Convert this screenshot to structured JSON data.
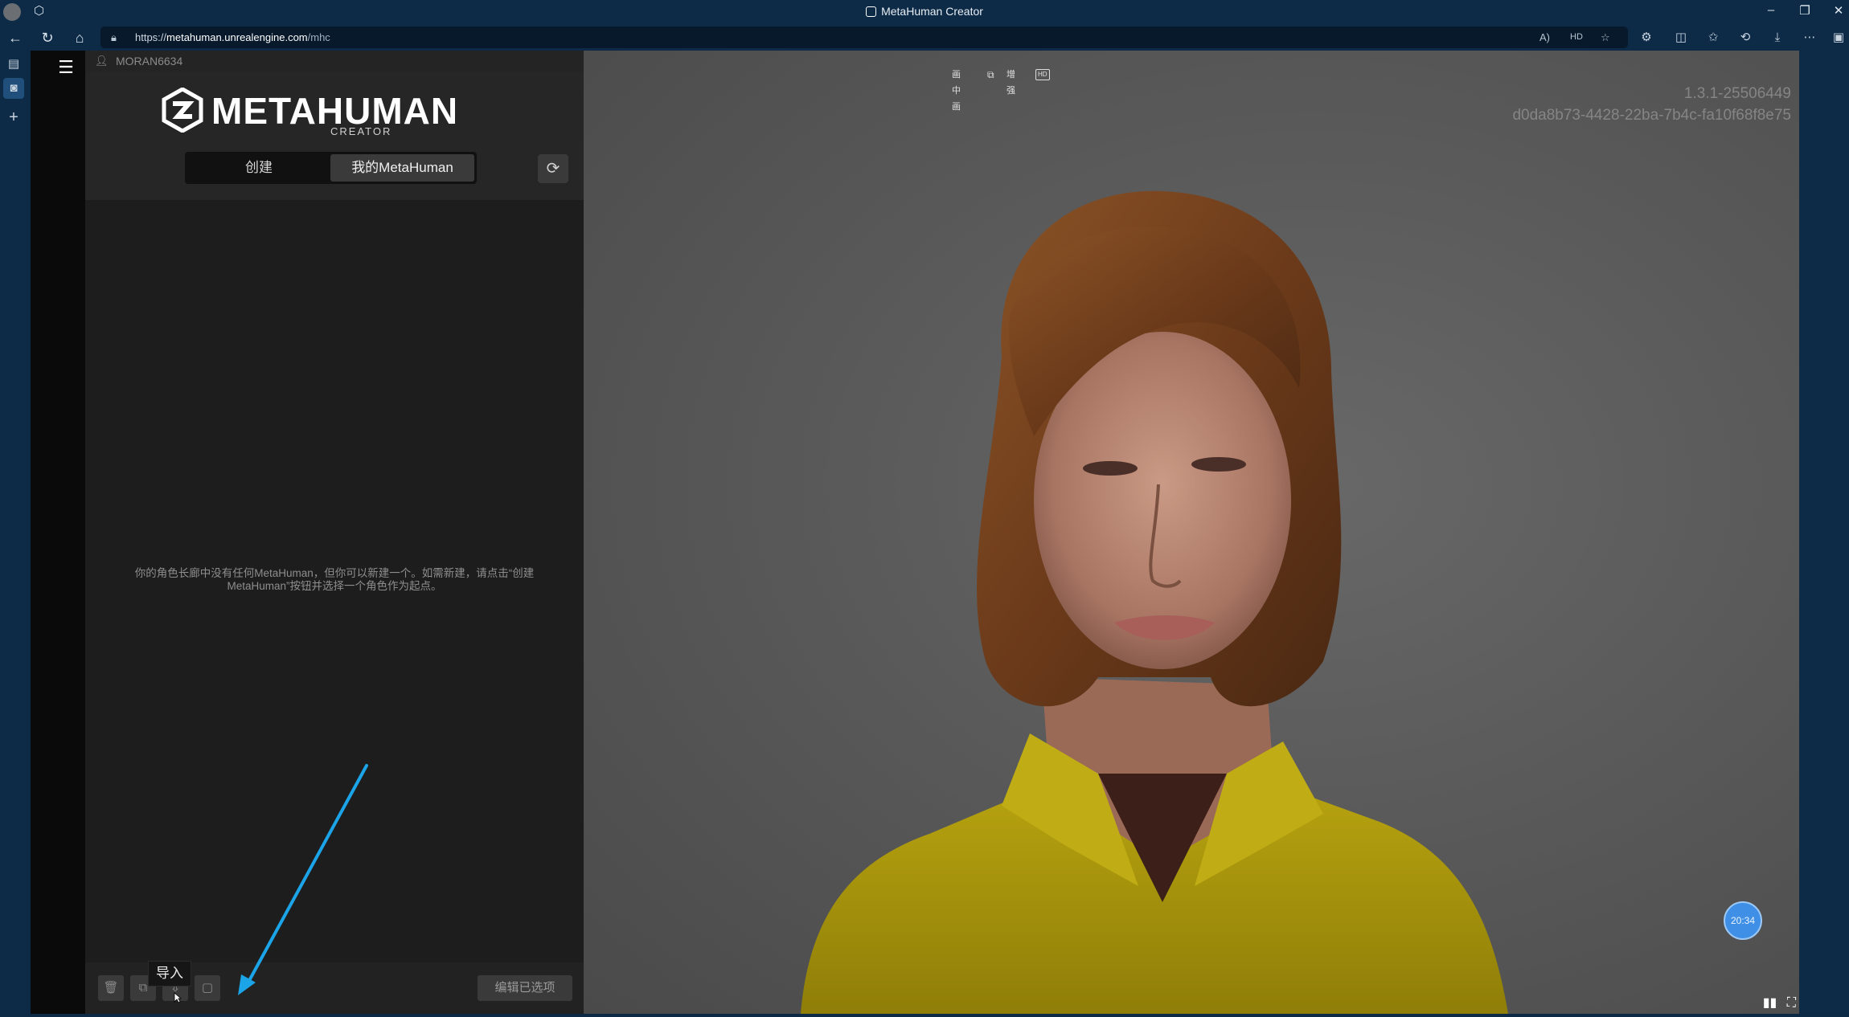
{
  "browser": {
    "window_title": "MetaHuman Creator",
    "url_prefix": "https://",
    "url_host": "metahuman.unrealengine.com",
    "url_path": "/mhc"
  },
  "user": {
    "name": "MORAN6634"
  },
  "brand": {
    "logo_word": "METAHUMAN",
    "logo_sub": "CREATOR"
  },
  "tabs": {
    "create": "创建",
    "mine": "我的MetaHuman"
  },
  "empty_message": "你的角色长廊中没有任何MetaHuman，但你可以新建一个。如需新建，请点击“创建MetaHuman”按钮并选择一个角色作为起点。",
  "footer": {
    "tooltip": "导入",
    "edit_button": "编辑已选项"
  },
  "viewport": {
    "tools": [
      "画中画",
      "增强",
      "HD"
    ],
    "version": "1.3.1-25506449",
    "build_id": "d0da8b73-4428-22ba-7b4c-fa10f68f8e75",
    "time_badge": "20:34"
  },
  "colors": {
    "arrow": "#1ba4e8",
    "badge": "#3f8fe6",
    "chrome": "#0d2b47",
    "shirt": "#b5a20f",
    "hair": "#7a4520"
  }
}
